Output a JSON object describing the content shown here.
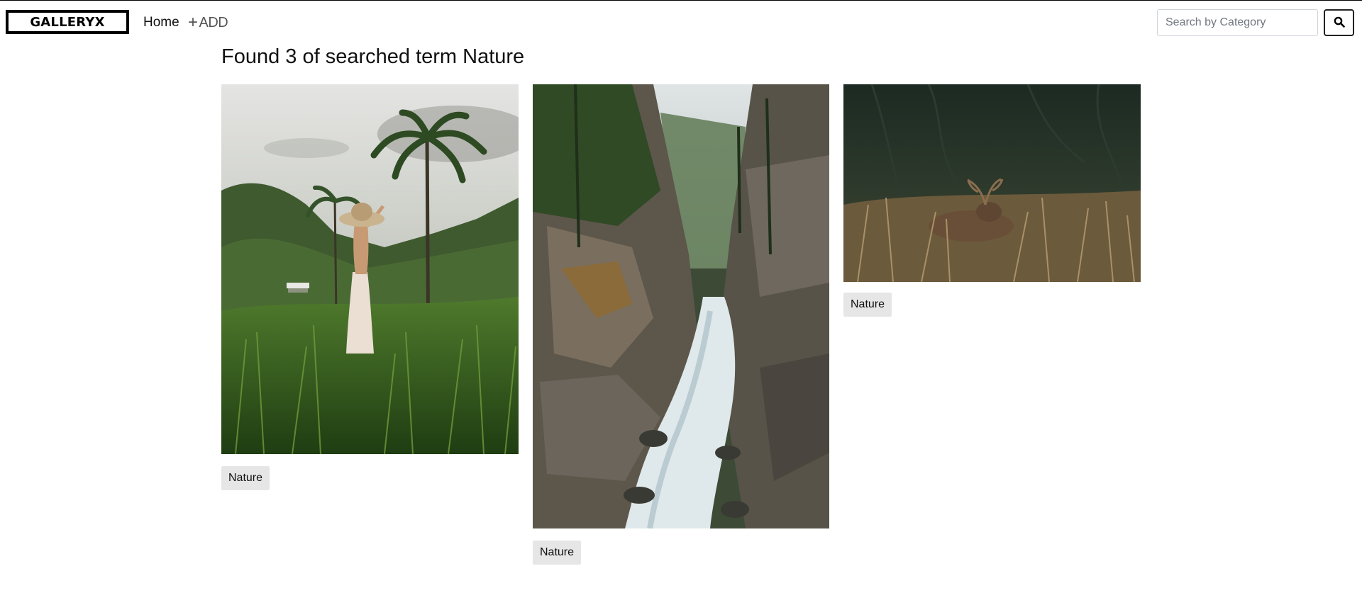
{
  "navbar": {
    "brand": "GALLERYX",
    "home_label": "Home",
    "add_label": "ADD",
    "add_icon": "plus-icon",
    "search": {
      "placeholder": "Search by Category",
      "value": "",
      "button_icon": "search-icon"
    }
  },
  "results": {
    "title": "Found 3 of searched term Nature"
  },
  "images": [
    {
      "subject": "woman in hat and white skirt among rice terraces and palm trees",
      "tag": "Nature"
    },
    {
      "subject": "mountain river flowing through rocky gorge with pine trees",
      "tag": "Nature"
    },
    {
      "subject": "stag deer resting in tall grass in dark forest",
      "tag": "Nature"
    }
  ],
  "colors": {
    "tag_bg": "#e6e6e6",
    "brand_border": "#000000",
    "input_border": "#cfd4d9"
  }
}
